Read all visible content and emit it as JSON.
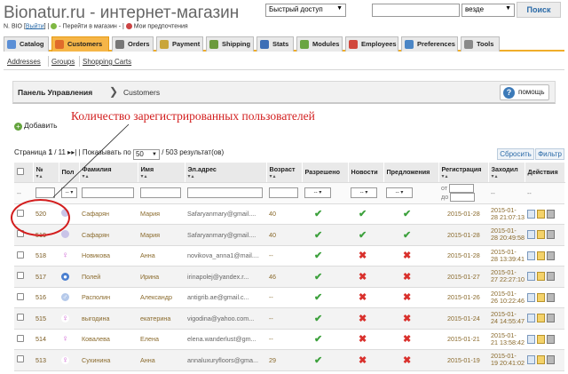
{
  "header": {
    "title": "Bionatur.ru - интернет-магазин",
    "quick_access": "Быстрый доступ",
    "scope": "везде",
    "search_button": "Поиск",
    "user_initials": "N. BIO",
    "logout": "Выйти",
    "go_to_shop": "- Перейти в магазин -",
    "preferences_link": "Мои предпочтения"
  },
  "tabs": [
    {
      "label": "Catalog",
      "color": "#5b8fd6"
    },
    {
      "label": "Customers",
      "color": "#e06b2b"
    },
    {
      "label": "Orders",
      "color": "#777777"
    },
    {
      "label": "Payment",
      "color": "#c9a53a"
    },
    {
      "label": "Shipping",
      "color": "#6b9a3c"
    },
    {
      "label": "Stats",
      "color": "#3d6fb6"
    },
    {
      "label": "Modules",
      "color": "#6aa541"
    },
    {
      "label": "Employees",
      "color": "#d1473b"
    },
    {
      "label": "Preferences",
      "color": "#4b86c6"
    },
    {
      "label": "Tools",
      "color": "#8a8a8a"
    }
  ],
  "subnav": [
    "Addresses",
    "Groups",
    "Shopping Carts"
  ],
  "breadcrumb": {
    "root": "Панель Управления",
    "separator": "❯",
    "current": "Customers"
  },
  "help_label": "помощь",
  "add_label": "Добавить",
  "annotation": "Количество зарегистрированных пользователей",
  "pager": {
    "prefix": "Страница",
    "page": "1",
    "of": "/ 11",
    "arrows": "▸▸|",
    "show_label": "| Показывать по",
    "per_page": "50",
    "results": "/ 503 результат(ов)"
  },
  "reset_label": "Сбросить",
  "filter_label": "Фильтр",
  "columns": {
    "id": "№",
    "sort_arrows": "▾▴",
    "gender": "Пол",
    "last": "Фамилия",
    "first": "Имя",
    "email": "Эл.адрес",
    "age": "Возраст",
    "active": "Разрешено",
    "news": "Новости",
    "optin": "Предложения",
    "registered": "Регистрация",
    "last_visit": "Заходил",
    "actions": "Действия"
  },
  "filter_row": {
    "dash": "--",
    "from": "от",
    "to": "до",
    "select": "-- ▾"
  },
  "rows": [
    {
      "id": "520",
      "gender": "none",
      "last": "Сафарян",
      "first": "Мария",
      "email": "Safaryanmary@gmail....",
      "age": "40",
      "active": true,
      "news": true,
      "optin": true,
      "registered": "2015-01-28",
      "visit_date": "2015-01-",
      "visit_time": "28 21:07:13"
    },
    {
      "id": "519",
      "gender": "none",
      "last": "Сафарян",
      "first": "Мария",
      "email": "Safaryanmary@gmail....",
      "age": "40",
      "active": true,
      "news": true,
      "optin": true,
      "registered": "2015-01-28",
      "visit_date": "2015-01-",
      "visit_time": "28 20:49:58"
    },
    {
      "id": "518",
      "gender": "f",
      "last": "Новикова",
      "first": "Анна",
      "email": "novikova_anna1@mail....",
      "age": "--",
      "active": true,
      "news": false,
      "optin": false,
      "registered": "2015-01-28",
      "visit_date": "2015-01-",
      "visit_time": "28 13:39:41"
    },
    {
      "id": "517",
      "gender": "m",
      "last": "Полей",
      "first": "Ирина",
      "email": "irinapolej@yandex.r...",
      "age": "46",
      "active": true,
      "news": false,
      "optin": false,
      "registered": "2015-01-27",
      "visit_date": "2015-01-",
      "visit_time": "27 22:27:10"
    },
    {
      "id": "516",
      "gender": "q",
      "last": "Располин",
      "first": "Александр",
      "email": "antigrib.ae@gmail.c...",
      "age": "--",
      "active": true,
      "news": false,
      "optin": false,
      "registered": "2015-01-26",
      "visit_date": "2015-01-",
      "visit_time": "26 10:22:46"
    },
    {
      "id": "515",
      "gender": "f",
      "last": "выгодина",
      "first": "екатерина",
      "email": "vigodina@yahoo.com...",
      "age": "--",
      "active": true,
      "news": false,
      "optin": false,
      "registered": "2015-01-24",
      "visit_date": "2015-01-",
      "visit_time": "24 14:55:47"
    },
    {
      "id": "514",
      "gender": "f",
      "last": "Ковалева",
      "first": "Елена",
      "email": "elena.wanderlust@gm...",
      "age": "--",
      "active": true,
      "news": false,
      "optin": false,
      "registered": "2015-01-21",
      "visit_date": "2015-01-",
      "visit_time": "21 13:58:42"
    },
    {
      "id": "513",
      "gender": "f",
      "last": "Сухинина",
      "first": "Анна",
      "email": "annaluxuryfloors@gma...",
      "age": "29",
      "active": true,
      "news": false,
      "optin": false,
      "registered": "2015-01-19",
      "visit_date": "2015-01-",
      "visit_time": "19 20:41:02"
    }
  ],
  "icons": {
    "check": "✔",
    "cross": "✖"
  }
}
